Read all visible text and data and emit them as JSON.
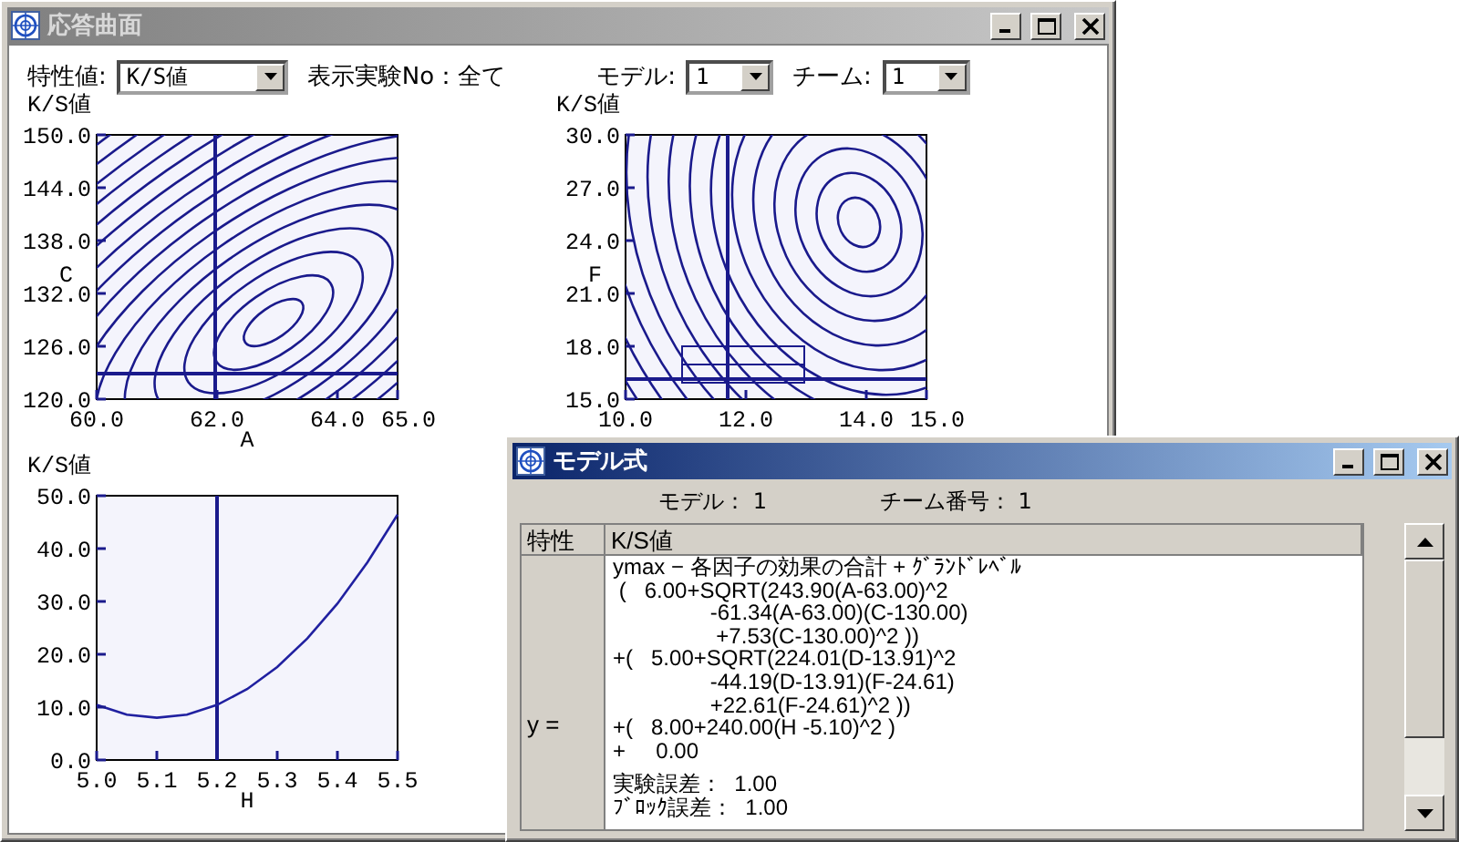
{
  "main_window": {
    "title": "応答曲面",
    "active": false,
    "toolbar": {
      "characteristic": {
        "label": "特性値:",
        "value": "K/S値"
      },
      "experiment_info": "表示実験No：全て",
      "model": {
        "label": "モデル:",
        "value": "1"
      },
      "team": {
        "label": "チーム:",
        "value": "1"
      }
    },
    "charts": [
      {
        "kind": "contour",
        "title": "K/S値",
        "ylabel": "C",
        "xlabel": "A",
        "xticks": [
          "60.0",
          "62.0",
          "64.0",
          "65.0"
        ],
        "yticks": [
          "150.0",
          "144.0",
          "138.0",
          "132.0",
          "126.0",
          "120.0"
        ]
      },
      {
        "kind": "contour",
        "title": "K/S値",
        "ylabel": "F",
        "xticks": [
          "10.0",
          "12.0",
          "14.0",
          "15.0"
        ],
        "yticks": [
          "30.0",
          "27.0",
          "24.0",
          "21.0",
          "18.0",
          "15.0"
        ]
      },
      {
        "kind": "line",
        "chart_data": {
          "type": "line",
          "title": "K/S値",
          "xlabel": "H",
          "x": [
            5.0,
            5.05,
            5.1,
            5.15,
            5.2,
            5.25,
            5.3,
            5.35,
            5.4,
            5.45,
            5.5
          ],
          "series": [
            {
              "color": "#2020a0",
              "values": [
                10.4,
                8.6,
                8.0,
                8.6,
                10.4,
                13.4,
                17.6,
                23.0,
                29.6,
                37.4,
                46.4
              ]
            }
          ],
          "xlim": [
            5.0,
            5.5
          ],
          "ylim": [
            0,
            50
          ],
          "xticks": [
            {
              "value": 5.0,
              "label": "5.0"
            },
            {
              "value": 5.1,
              "label": "5.1"
            },
            {
              "value": 5.2,
              "label": "5.2"
            },
            {
              "value": 5.3,
              "label": "5.3"
            },
            {
              "value": 5.4,
              "label": "5.4"
            },
            {
              "value": 5.5,
              "label": "5.5"
            }
          ],
          "yticks": [
            {
              "value": 0,
              "label": "0.0"
            },
            {
              "value": 10,
              "label": "10.0"
            },
            {
              "value": 20,
              "label": "20.0"
            },
            {
              "value": 30,
              "label": "30.0"
            },
            {
              "value": 40,
              "label": "40.0"
            },
            {
              "value": 50,
              "label": "50.0"
            }
          ],
          "ref_lines": [
            {
              "axis": "x",
              "value": 5.2
            }
          ]
        }
      }
    ]
  },
  "model_window": {
    "title": "モデル式",
    "active": true,
    "model_info": "モデル： 1",
    "team_info": "チーム番号： 1",
    "table": {
      "columns": [
        "特性",
        "K/S値"
      ],
      "row_label": "y =",
      "formula_lines": [
        "ymax − 各因子の効果の合計 + ｸﾞﾗﾝﾄﾞﾚﾍﾞﾙ",
        " (   6.00+SQRT(243.90(A-63.00)^2",
        "                -61.34(A-63.00)(C-130.00)",
        "                 +7.53(C-130.00)^2 ))",
        "+(   5.00+SQRT(224.01(D-13.91)^2",
        "                -44.19(D-13.91)(F-24.61)",
        "                +22.61(F-24.61)^2 ))",
        "+(   8.00+240.00(H -5.10)^2 )",
        "+     0.00"
      ],
      "error_lines": [
        "実験誤差：  1.00",
        "ﾌﾞﾛｯｸ誤差：  1.00"
      ]
    }
  }
}
